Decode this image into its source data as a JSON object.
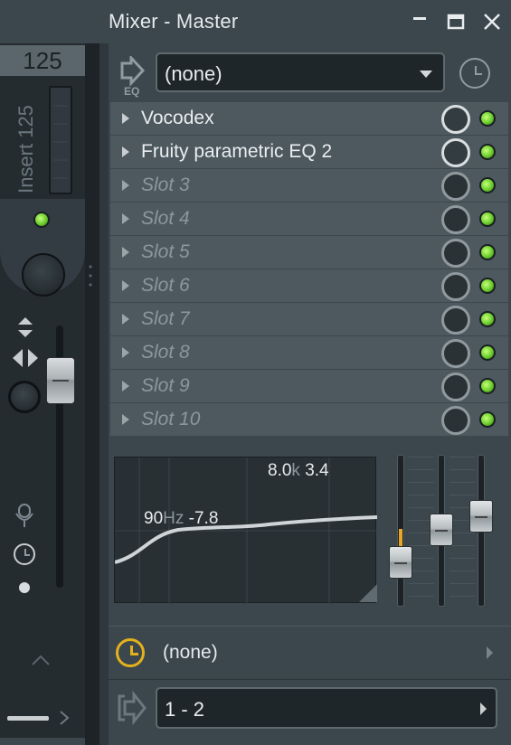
{
  "window": {
    "title": "Mixer - Master",
    "minimize_icon": "minimize-icon",
    "maximize_icon": "maximize-icon",
    "close_icon": "close-icon"
  },
  "channel": {
    "number": "125",
    "name": "Insert 125",
    "led_color": "#7ee03a"
  },
  "effects": {
    "eq_label": "EQ",
    "preset_value": "(none)",
    "slots": [
      {
        "label": "Vocodex",
        "loaded": true
      },
      {
        "label": "Fruity parametric EQ 2",
        "loaded": true
      },
      {
        "label": "Slot 3",
        "loaded": false
      },
      {
        "label": "Slot 4",
        "loaded": false
      },
      {
        "label": "Slot 5",
        "loaded": false
      },
      {
        "label": "Slot 6",
        "loaded": false
      },
      {
        "label": "Slot 7",
        "loaded": false
      },
      {
        "label": "Slot 8",
        "loaded": false
      },
      {
        "label": "Slot 9",
        "loaded": false
      },
      {
        "label": "Slot 10",
        "loaded": false
      }
    ]
  },
  "eq": {
    "low_freq": "90",
    "low_unit": "Hz",
    "low_gain": "-7.8",
    "high_freq": "8.0",
    "high_unit": "k",
    "high_gain": "3.4",
    "accent_color": "#e8a726"
  },
  "automation": {
    "value": "(none)",
    "accent_color": "#e3b21b"
  },
  "output": {
    "value": "1 - 2"
  }
}
